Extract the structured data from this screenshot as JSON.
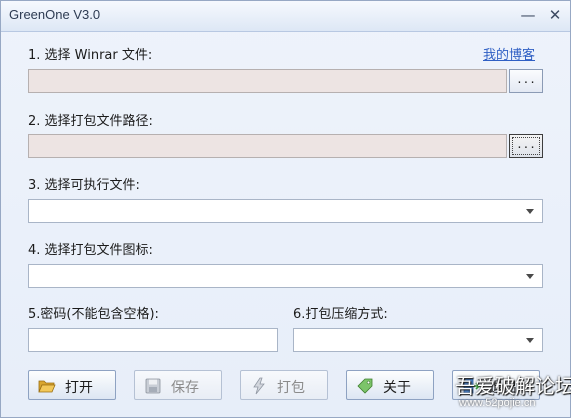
{
  "window": {
    "title": "GreenOne V3.0",
    "minimize_glyph": "—",
    "close_glyph": "✕"
  },
  "form": {
    "winrar_label": "1. 选择 Winrar 文件:",
    "blog_link": "我的博客",
    "winrar_browse": "...",
    "pack_path_label": "2. 选择打包文件路径:",
    "pack_path_browse": "...",
    "exec_label": "3. 选择可执行文件:",
    "icon_label": "4. 选择打包文件图标:",
    "password_label": "5.密码(不能包含空格):",
    "compress_label": "6.打包压缩方式:"
  },
  "buttons": {
    "open": "打开",
    "save": "保存",
    "pack": "打包",
    "about": "关于",
    "exit": "退出"
  },
  "watermark": {
    "title": "吾爱破解论坛",
    "url": "www.52pojie.cn"
  },
  "colors": {
    "link": "#2f5fc4",
    "disabled_field": "#ede4e3",
    "title_text": "#2d3b52"
  }
}
